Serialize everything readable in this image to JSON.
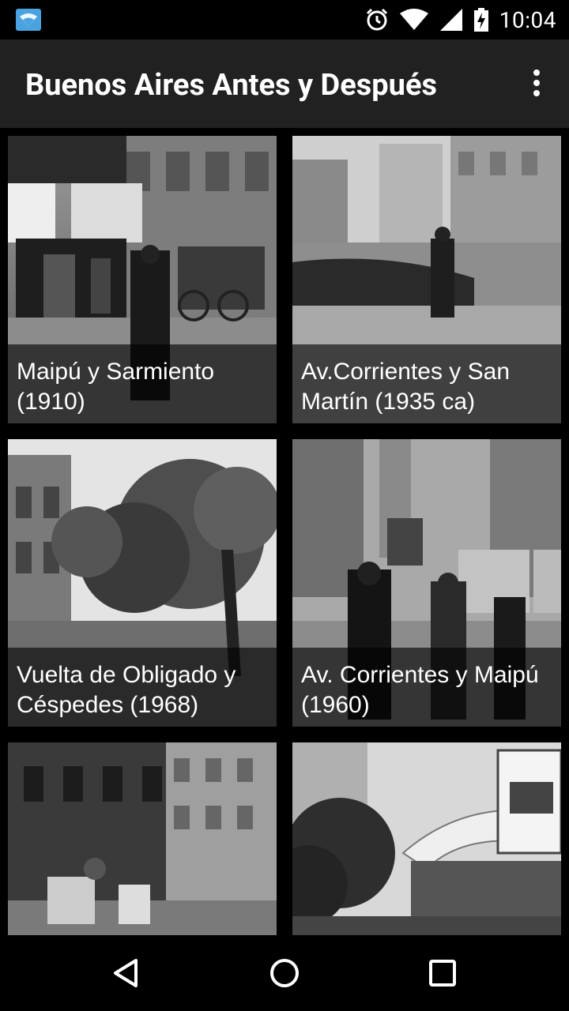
{
  "status_bar": {
    "time": "10:04",
    "icons": [
      "wifi-notification-icon",
      "alarm-icon",
      "wifi-icon",
      "signal-icon",
      "battery-charging-icon"
    ]
  },
  "app_bar": {
    "title": "Buenos Aires Antes y Después",
    "overflow_icon": "more-vert-icon"
  },
  "gallery": {
    "items": [
      {
        "caption": "Maipú y Sarmiento (1910)"
      },
      {
        "caption": "Av.Corrientes y San Martín (1935 ca)"
      },
      {
        "caption": "Vuelta de Obligado y Céspedes (1968)"
      },
      {
        "caption": "Av. Corrientes y Maipú (1960)"
      },
      {
        "caption": ""
      },
      {
        "caption": ""
      }
    ]
  },
  "nav_bar": {
    "buttons": [
      "back-icon",
      "home-icon",
      "recents-icon"
    ]
  }
}
